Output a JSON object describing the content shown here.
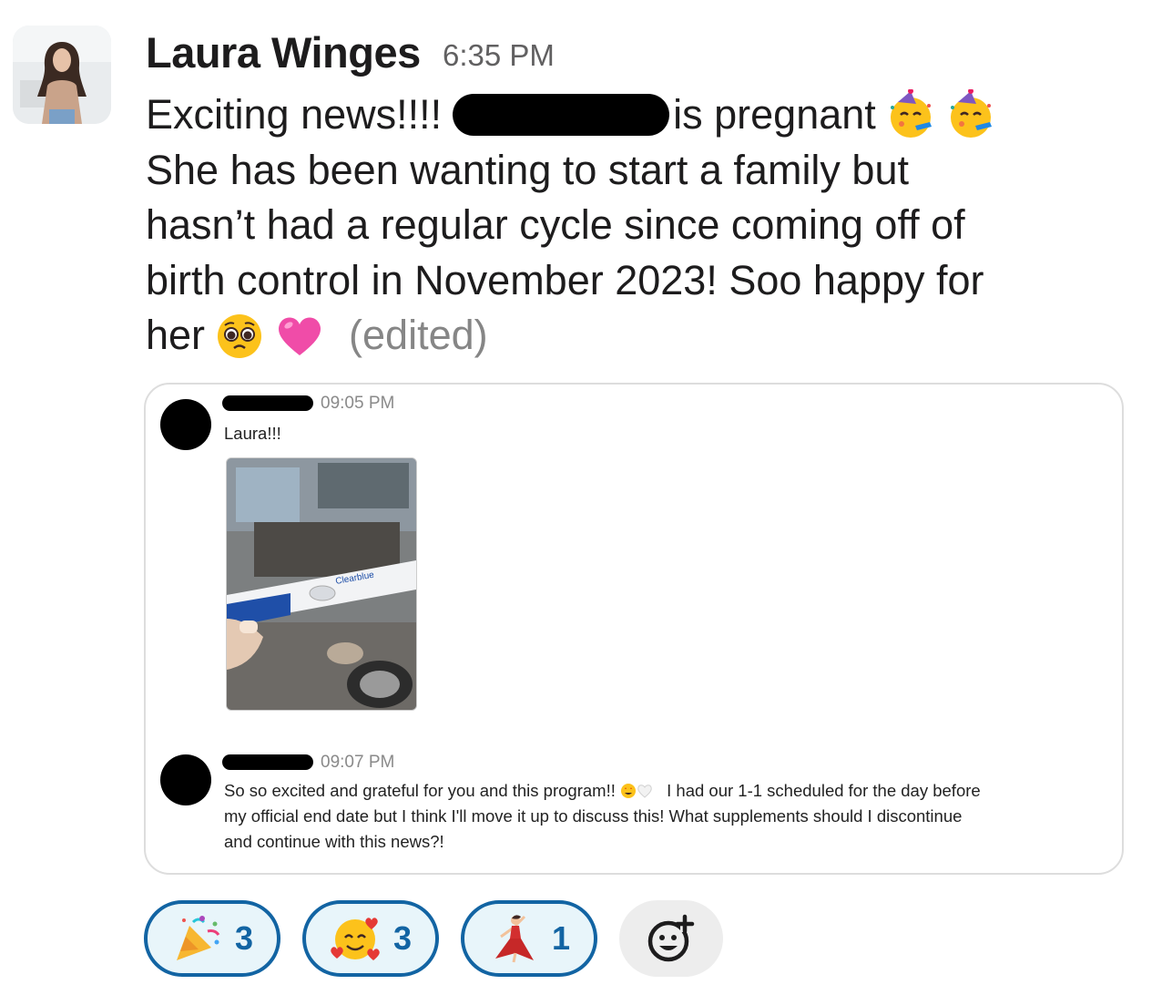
{
  "message": {
    "author": "Laura Winges",
    "time": "6:35 PM",
    "line1_start": "Exciting news!!!!",
    "line1_end": "is pregnant",
    "line2": "She has been wanting to start a family but",
    "line3": "hasn’t had a regular cycle since coming off of",
    "line4": "birth control in November 2023! Soo happy for",
    "line5": "her",
    "edited": "(edited)",
    "emoji": {
      "partying": "partying-face-emoji",
      "pleading": "pleading-face-emoji",
      "heart": "pink-heart-emoji"
    }
  },
  "embed": {
    "first": {
      "time": "09:05 PM",
      "text": "Laura!!!",
      "photo_text": "Clearbluе"
    },
    "second": {
      "time": "09:07 PM",
      "text_a": "So so excited and grateful for you and this program!!",
      "text_b": "I had our 1-1 scheduled for the day before",
      "text_c": "my official end date but I think I'll move it up to discuss this! What supplements should I discontinue",
      "text_d": "and continue with this news?!"
    }
  },
  "reactions": [
    {
      "emoji": "party-popper-emoji",
      "count": "3"
    },
    {
      "emoji": "smiling-face-with-hearts-emoji",
      "count": "3"
    },
    {
      "emoji": "dancer-emoji",
      "count": "1"
    }
  ],
  "colors": {
    "accent": "#1264a3",
    "reaction_bg": "#e8f5fa",
    "text": "#1d1c1d",
    "muted": "#616061"
  }
}
